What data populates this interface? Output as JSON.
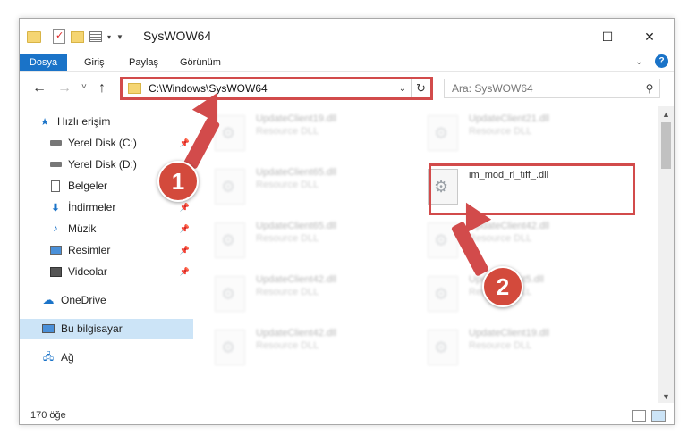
{
  "window": {
    "title": "SysWOW64",
    "minimize_icon": "minimize-icon",
    "maximize_icon": "maximize-icon",
    "close_icon": "close-icon"
  },
  "menu": {
    "items": [
      "Dosya",
      "Giriş",
      "Paylaş",
      "Görünüm"
    ],
    "active": "Dosya"
  },
  "nav": {
    "address": "C:\\Windows\\SysWOW64",
    "search_placeholder": "Ara: SysWOW64"
  },
  "sidebar": {
    "items": [
      {
        "label": "Hızlı erişim",
        "icon": "star-icon"
      },
      {
        "label": "Yerel Disk (C:)",
        "icon": "drive-icon",
        "pinned": true
      },
      {
        "label": "Yerel Disk (D:)",
        "icon": "drive-icon",
        "pinned": true
      },
      {
        "label": "Belgeler",
        "icon": "document-icon",
        "pinned": true
      },
      {
        "label": "İndirmeler",
        "icon": "download-icon",
        "pinned": true
      },
      {
        "label": "Müzik",
        "icon": "music-icon",
        "pinned": true
      },
      {
        "label": "Resimler",
        "icon": "pictures-icon",
        "pinned": true
      },
      {
        "label": "Videolar",
        "icon": "video-icon",
        "pinned": true
      },
      {
        "label": "OneDrive",
        "icon": "cloud-icon"
      },
      {
        "label": "Bu bilgisayar",
        "icon": "computer-icon",
        "selected": true
      },
      {
        "label": "Ağ",
        "icon": "network-icon"
      }
    ]
  },
  "files": [
    {
      "name": "UpdateClient19.dll",
      "type": "Resource DLL"
    },
    {
      "name": "UpdateClient21.dll",
      "type": "Resource DLL"
    },
    {
      "name": "UpdateClient65.dll",
      "type": "Resource DLL"
    },
    {
      "name": "im_mod_rl_tiff_.dll",
      "type": ""
    },
    {
      "name": "UpdateClient65.dll",
      "type": "Resource DLL"
    },
    {
      "name": "UpdateClient42.dll",
      "type": "Resource DLL"
    },
    {
      "name": "UpdateClient42.dll",
      "type": "Resource DLL"
    },
    {
      "name": "UpdateClient5.dll",
      "type": "Resource DLL"
    },
    {
      "name": "UpdateClient42.dll",
      "type": "Resource DLL"
    },
    {
      "name": "UpdateClient19.dll",
      "type": "Resource DLL"
    }
  ],
  "status": {
    "count": "170 öğe"
  },
  "annotations": {
    "badge1": "1",
    "badge2": "2",
    "color": "#d24b4b"
  }
}
